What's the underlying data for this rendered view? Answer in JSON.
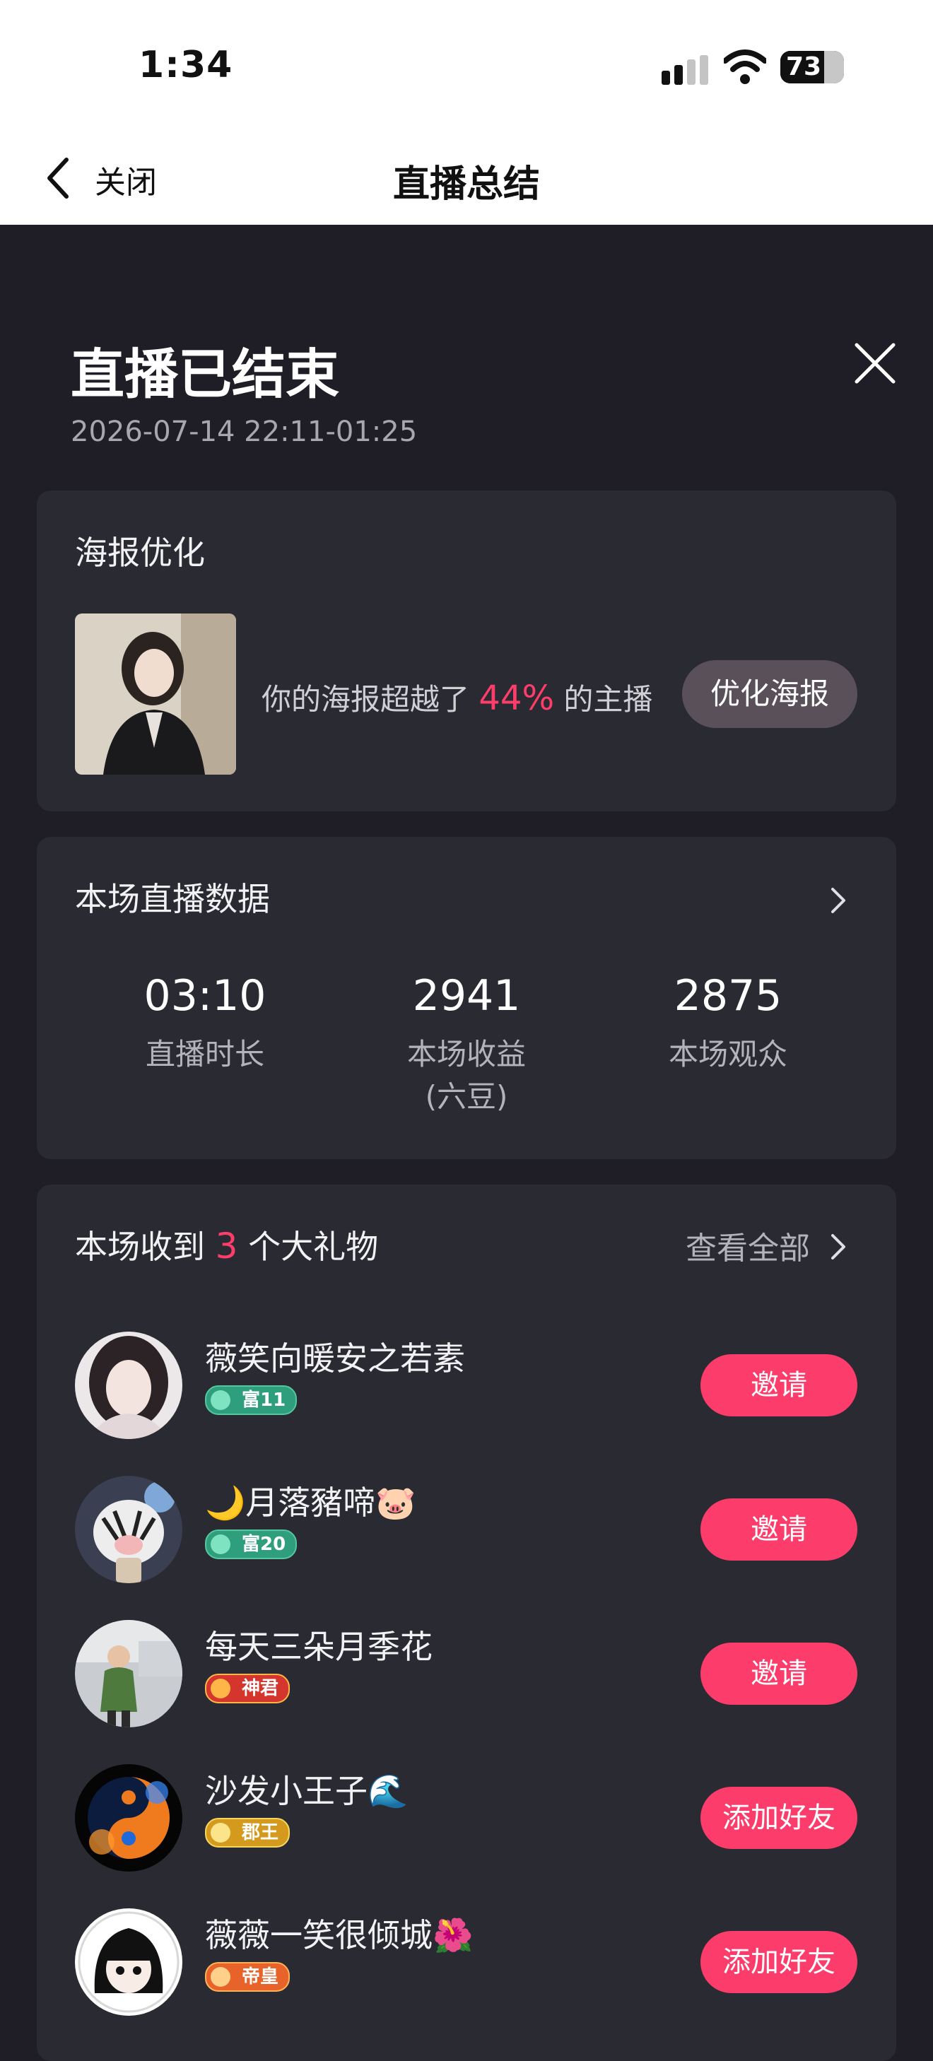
{
  "status_bar": {
    "time": "1:34",
    "battery": "73"
  },
  "nav": {
    "back_label": "关闭",
    "title": "直播总结"
  },
  "header": {
    "title": "直播已结束",
    "date": "2026-07-14 22:11-01:25"
  },
  "poster_card": {
    "title": "海报优化",
    "text_prefix": "你的海报超越了",
    "percent": "44%",
    "text_suffix": "的主播",
    "button": "优化海报"
  },
  "stats_card": {
    "title": "本场直播数据",
    "stats": [
      {
        "value": "03:10",
        "label": "直播时长",
        "sub": ""
      },
      {
        "value": "2941",
        "label": "本场收益",
        "sub": "(六豆)"
      },
      {
        "value": "2875",
        "label": "本场观众",
        "sub": ""
      }
    ]
  },
  "gifts_card": {
    "title_prefix": "本场收到",
    "count": "3",
    "title_suffix": "个大礼物",
    "view_all": "查看全部",
    "users": [
      {
        "name": "薇笑向暖安之若素",
        "badge": "富11",
        "action": "邀请"
      },
      {
        "name": "🌙月落豬啼🐷",
        "badge": "富20",
        "action": "邀请"
      },
      {
        "name": "每天三朵月季花",
        "badge": "神君",
        "action": "邀请"
      },
      {
        "name": "沙发小王子🌊",
        "badge": "郡王",
        "action": "添加好友"
      },
      {
        "name": "薇薇一笑很倾城🌺",
        "badge": "帝皇",
        "action": "添加好友"
      }
    ]
  },
  "colors": {
    "accent": "#fc3d6c",
    "background": "#1f1e27",
    "card": "#2a2a33"
  }
}
